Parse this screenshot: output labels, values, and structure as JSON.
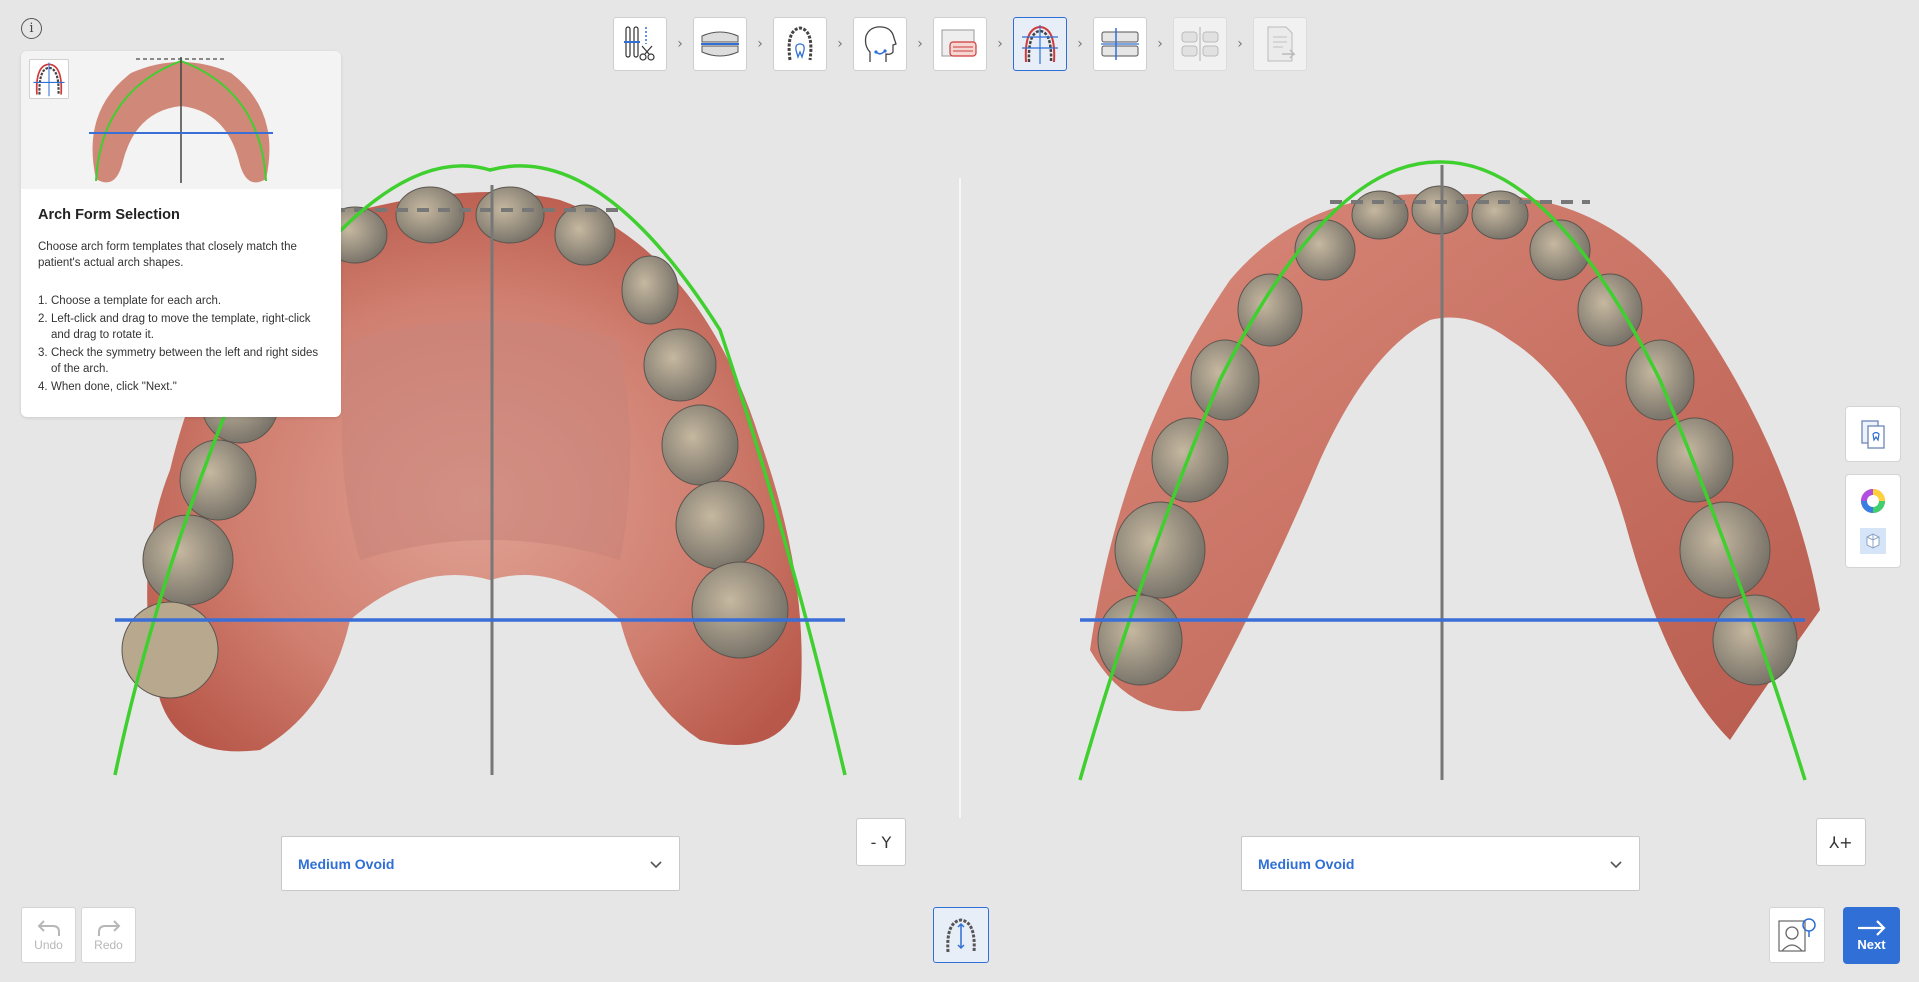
{
  "colors": {
    "accent": "#2f6fd6",
    "arch_curve": "#3fcf2f",
    "reference_line": "#3a6fd8",
    "midline": "#777777",
    "gum": "#cf7564",
    "tooth": "#a89c88"
  },
  "info_button": {
    "icon": "info-icon",
    "label": "i"
  },
  "workflow_steps": [
    {
      "name": "tools",
      "icon": "tools-icon",
      "state": "done"
    },
    {
      "name": "occlusion",
      "icon": "occlusion-icon",
      "state": "done"
    },
    {
      "name": "tooth-segmentation",
      "icon": "tooth-segmentation-icon",
      "state": "done"
    },
    {
      "name": "face-alignment",
      "icon": "face-icon",
      "state": "done"
    },
    {
      "name": "xray",
      "icon": "xray-icon",
      "state": "done"
    },
    {
      "name": "arch-form",
      "icon": "arch-form-icon",
      "state": "active"
    },
    {
      "name": "bracket",
      "icon": "bracket-icon",
      "state": "next"
    },
    {
      "name": "setup",
      "icon": "setup-icon",
      "state": "disabled"
    },
    {
      "name": "export",
      "icon": "export-icon",
      "state": "disabled"
    }
  ],
  "guide": {
    "title": "Arch Form Selection",
    "description": "Choose arch form templates that closely match the patient's actual arch shapes.",
    "steps": [
      {
        "num": "1.",
        "text": "Choose a template for each arch."
      },
      {
        "num": "2.",
        "text": "Left-click and drag to move the template, right-click and drag to rotate it."
      },
      {
        "num": "3.",
        "text": "Check the symmetry between the left and right sides of the arch."
      },
      {
        "num": "4.",
        "text": "When done, click \"Next.\""
      }
    ]
  },
  "upper_arch": {
    "template": "Medium Ovoid",
    "view_label": "- Y"
  },
  "lower_arch": {
    "template": "Medium Ovoid",
    "view_label": "⅄+"
  },
  "right_tools": [
    "compare-icon",
    "color-wheel-icon",
    "cube-icon"
  ],
  "history": {
    "undo_label": "Undo",
    "redo_label": "Redo"
  },
  "footer": {
    "next_label": "Next"
  }
}
